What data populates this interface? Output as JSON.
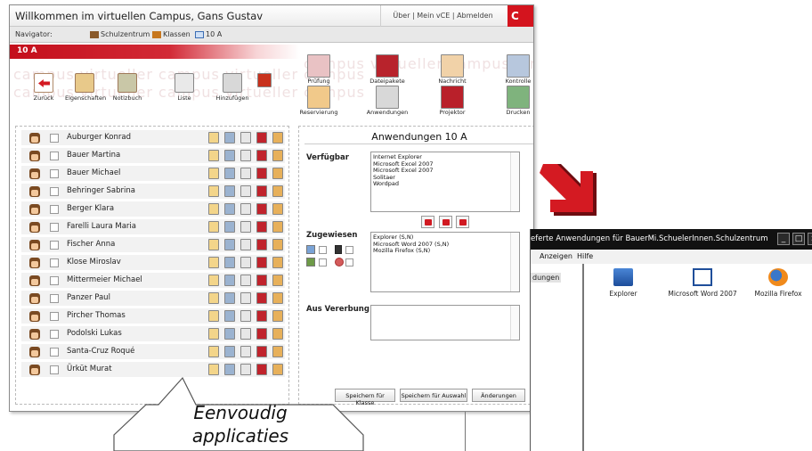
{
  "window": {
    "title": "Willkommen im virtuellen Campus, Gans Gustav",
    "header_links": "Über | Mein vCE | Abmelden",
    "brand_letter": "C"
  },
  "navigator": {
    "label": "Navigator:",
    "crumbs": [
      "Schulzentrum",
      "Klassen",
      "10 A"
    ]
  },
  "classbar": {
    "label": "10 A"
  },
  "watermark_text": "campus virtueller campus virtueller campus",
  "toolbar": {
    "left": [
      "Zurück",
      "Eigenschaften",
      "Notizbuch",
      "Liste",
      "Hinzufügen"
    ],
    "right_row1": [
      "Prüfung",
      "Dateipakete",
      "Nachricht",
      "Kontrolle"
    ],
    "right_row2": [
      "Reservierung",
      "Anwendungen",
      "Projektor",
      "Drucken"
    ]
  },
  "students": [
    "Auburger Konrad",
    "Bauer Martina",
    "Bauer Michael",
    "Behringer Sabrina",
    "Berger Klara",
    "Farelli Laura Maria",
    "Fischer Anna",
    "Klose Miroslav",
    "Mittermeier Michael",
    "Panzer Paul",
    "Pircher Thomas",
    "Podolski Lukas",
    "Santa-Cruz Roqué",
    "Ürküt Murat"
  ],
  "apps_panel": {
    "title": "Anwendungen 10 A",
    "available_label": "Verfügbar",
    "available": [
      "Internet Explorer",
      "Microsoft Excel 2007",
      "Microsoft Excel 2007",
      "Solitaer",
      "Wordpad"
    ],
    "assigned_label": "Zugewiesen",
    "assigned": [
      "Explorer (S,N)",
      "Microsoft Word 2007 (S,N)",
      "Mozilla Firefox (S,N)"
    ],
    "inherit_label": "Aus Vererbung",
    "buttons": [
      "Speichern für Klasse",
      "Speichern für Auswahl",
      "Änderungen"
    ]
  },
  "window2": {
    "title": "eferte Anwendungen für BauerMi.SchuelerInnen.Schulzentrum",
    "menu": [
      "Anzeigen",
      "Hilfe"
    ],
    "left_fragment": "dungen",
    "apps": [
      "Explorer",
      "Microsoft Word 2007",
      "Mozilla Firefox"
    ]
  },
  "callout": {
    "line1": "Eenvoudig",
    "line2": "applicaties"
  },
  "colors": {
    "accent_red": "#c40e1b",
    "title_black": "#111111"
  }
}
